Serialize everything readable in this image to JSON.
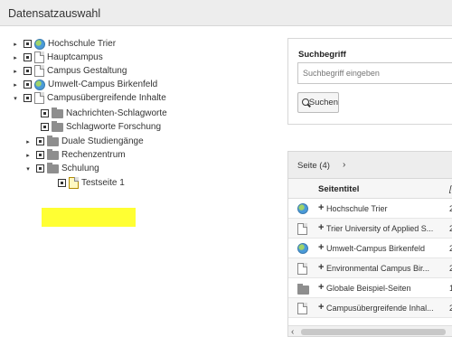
{
  "header": {
    "title": "Datensatzauswahl"
  },
  "tree": {
    "items": [
      {
        "label": "Hochschule Trier",
        "icon": "globe-icon",
        "expander": "▸"
      },
      {
        "label": "Hauptcampus",
        "icon": "page-icon",
        "expander": "▸"
      },
      {
        "label": "Campus Gestaltung",
        "icon": "page-icon",
        "expander": "▸"
      },
      {
        "label": "Umwelt-Campus Birkenfeld",
        "icon": "globe-icon",
        "expander": "▸"
      },
      {
        "label": "Campusübergreifende Inhalte",
        "icon": "page-icon",
        "expander": "▾"
      },
      {
        "label": "Nachrichten-Schlagworte",
        "icon": "folder-icon",
        "expander": ""
      },
      {
        "label": "Schlagworte Forschung",
        "icon": "folder-icon",
        "expander": ""
      },
      {
        "label": "Duale Studiengänge",
        "icon": "folder-icon",
        "expander": "▸"
      },
      {
        "label": "Rechenzentrum",
        "icon": "folder-icon",
        "expander": "▸"
      },
      {
        "label": "Schulung",
        "icon": "folder-icon",
        "expander": "▾"
      },
      {
        "label": "Testseite 1",
        "icon": "page-icon",
        "expander": ""
      }
    ]
  },
  "search": {
    "label": "Suchbegriff",
    "placeholder": "Suchbegriff eingeben",
    "button_label": "Suchen"
  },
  "results": {
    "header": "Seite (4)",
    "chevron": "›",
    "col_title": "Seitentitel",
    "col_second": "[",
    "rows": [
      {
        "icon": "globe-icon",
        "plus": "+",
        "title": "Hochschule Trier",
        "last": "2"
      },
      {
        "icon": "page-icon",
        "plus": "+",
        "title": "Trier University of Applied S...",
        "last": "2"
      },
      {
        "icon": "globe-icon",
        "plus": "+",
        "title": "Umwelt-Campus Birkenfeld",
        "last": "2"
      },
      {
        "icon": "page-icon",
        "plus": "+",
        "title": "Environmental Campus Bir...",
        "last": "2"
      },
      {
        "icon": "folder-icon",
        "plus": "+",
        "title": "Globale Beispiel-Seiten",
        "last": "1"
      },
      {
        "icon": "page-icon",
        "plus": "+",
        "title": "Campusübergreifende Inhal...",
        "last": "2"
      }
    ],
    "scroll_left": "‹"
  }
}
